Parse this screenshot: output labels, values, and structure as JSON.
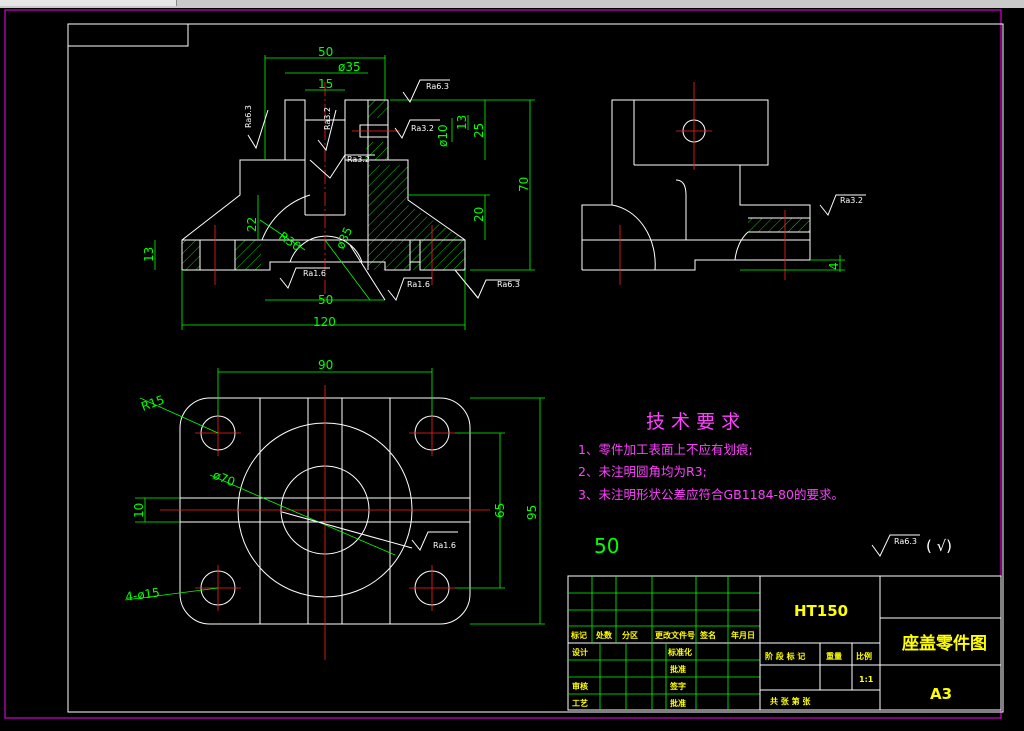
{
  "dims_front": {
    "d50_top": "50",
    "d35": "ø35",
    "d15": "15",
    "d10": "ø10",
    "d13_top": "13",
    "d25": "25",
    "d70": "70",
    "d20": "20",
    "d22": "22",
    "r30": "R30",
    "d35b": "ø35",
    "d13_left": "13",
    "d50_bottom": "50",
    "d120": "120"
  },
  "rough_front": [
    "Ra6.3",
    "Ra6.3",
    "Ra3.2",
    "Ra3.2",
    "Ra3.2",
    "Ra1.6",
    "Ra1.6",
    "Ra6.3"
  ],
  "dims_side": {
    "ra": "Ra3.2",
    "d4": "4"
  },
  "dims_top": {
    "d90": "90",
    "r15": "R15",
    "d70": "ø70",
    "d10": "10",
    "d65": "65",
    "d95": "95",
    "holes": "4-ø15",
    "ra": "Ra1.6"
  },
  "tech": {
    "title": "技 术 要 求",
    "items": [
      "1、零件加工表面上不应有划痕;",
      "2、未注明圆角均为R3;",
      "3、未注明形状公差应符合GB1184-80的要求。"
    ]
  },
  "scale_note": "50",
  "general_rough": {
    "ra": "Ra6.3",
    "mark": "( √)"
  },
  "title_block": {
    "material": "HT150",
    "drawing_name": "座盖零件图",
    "code": "A3",
    "row1": [
      "标记",
      "处数",
      "分区",
      "更改文件号",
      "签名",
      "年月日"
    ],
    "left_labels": [
      "设计",
      "审核",
      "工艺"
    ],
    "mid_labels": [
      "标准化",
      "批准",
      "签字",
      "批准"
    ],
    "stage": "阶 段 标 记",
    "weight": "重量",
    "ratio_label": "比例",
    "ratio": "1:1",
    "sheets": "共   张  第   张"
  },
  "colors": {
    "outline": "#ffffff",
    "dimension": "#00ff00",
    "center": "#ff2020",
    "border": "#ff00ff",
    "titleblock_text": "#ffff00"
  }
}
